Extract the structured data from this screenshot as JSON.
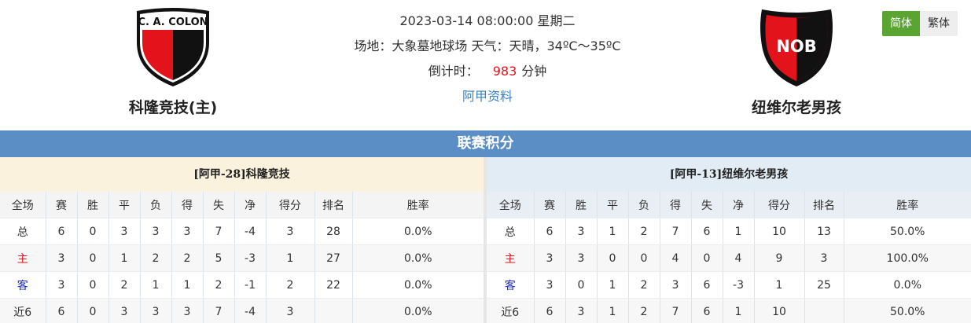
{
  "home": {
    "name": "科隆竞技(主)",
    "crest_text": "C. A. COLON",
    "crest_colors": [
      "#e3131b",
      "#111111"
    ],
    "panel_title": "[阿甲-28]科隆竞技",
    "rows": [
      {
        "type": "总",
        "type_class": "rt-total",
        "cells": [
          "6",
          "0",
          "3",
          "3",
          "3",
          "7",
          "-4",
          "3",
          "28",
          "0.0%"
        ]
      },
      {
        "type": "主",
        "type_class": "rt-home",
        "cells": [
          "3",
          "0",
          "1",
          "2",
          "2",
          "5",
          "-3",
          "1",
          "27",
          "0.0%"
        ]
      },
      {
        "type": "客",
        "type_class": "rt-away",
        "cells": [
          "3",
          "0",
          "2",
          "1",
          "1",
          "2",
          "-1",
          "2",
          "22",
          "0.0%"
        ]
      },
      {
        "type": "近6",
        "type_class": "rt-recent",
        "cells": [
          "6",
          "0",
          "3",
          "3",
          "3",
          "7",
          "-4",
          "3",
          "",
          "0.0%"
        ]
      }
    ]
  },
  "away": {
    "name": "纽维尔老男孩",
    "crest_text": "NOB",
    "crest_colors": [
      "#e3131b",
      "#111111"
    ],
    "panel_title": "[阿甲-13]纽维尔老男孩",
    "rows": [
      {
        "type": "总",
        "type_class": "rt-total",
        "cells": [
          "6",
          "3",
          "1",
          "2",
          "7",
          "6",
          "1",
          "10",
          "13",
          "50.0%"
        ]
      },
      {
        "type": "主",
        "type_class": "rt-home",
        "cells": [
          "3",
          "3",
          "0",
          "0",
          "4",
          "0",
          "4",
          "9",
          "3",
          "100.0%"
        ]
      },
      {
        "type": "客",
        "type_class": "rt-away",
        "cells": [
          "3",
          "0",
          "1",
          "2",
          "3",
          "6",
          "-3",
          "1",
          "25",
          "0.0%"
        ]
      },
      {
        "type": "近6",
        "type_class": "rt-recent",
        "cells": [
          "6",
          "3",
          "1",
          "2",
          "7",
          "6",
          "1",
          "10",
          "",
          "50.0%"
        ]
      }
    ]
  },
  "match": {
    "datetime": "2023-03-14 08:00:00 星期二",
    "venue_weather": "场地：大象墓地球场 天气：天晴，34ºC～35ºC",
    "countdown_label": "倒计时：",
    "countdown_value": "983",
    "countdown_unit": "分钟",
    "league_link": "阿甲资料"
  },
  "lang": {
    "simplified": "简体",
    "traditional": "繁体"
  },
  "section_title": "联赛积分",
  "columns": [
    "全场",
    "赛",
    "胜",
    "平",
    "负",
    "得",
    "失",
    "净",
    "得分",
    "排名",
    "胜率"
  ],
  "colors": {
    "accent_green": "#5aa532",
    "section_blue": "#5b8ec5",
    "home_type": "#e3131b",
    "away_type": "#1a2ec4"
  }
}
